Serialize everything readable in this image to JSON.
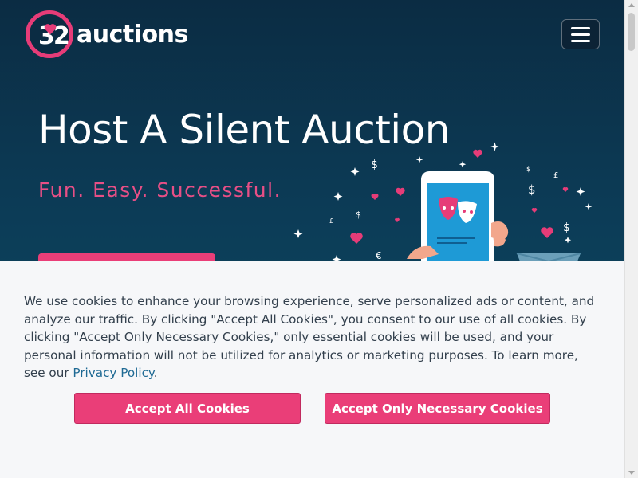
{
  "brand": {
    "digits": "32",
    "name": "auctions",
    "accent": "#e63c78"
  },
  "nav": {
    "menu_icon": "hamburger-icon"
  },
  "hero": {
    "title": "Host A Silent Auction",
    "subtitle": "Fun. Easy. Successful.",
    "background": "#0b3c57"
  },
  "cookie_banner": {
    "text_before_link": "We use cookies to enhance your browsing experience, serve personalized ads or content, and analyze our traffic. By clicking \"Accept All Cookies\", you consent to our use of all cookies. By clicking \"Accept Only Necessary Cookies,\" only essential cookies will be used, and your personal information will not be utilized for analytics or marketing purposes. To learn more, see our ",
    "link_text": "Privacy Policy",
    "text_after_link": ".",
    "accept_all_label": "Accept All Cookies",
    "accept_necessary_label": "Accept Only Necessary Cookies",
    "button_color": "#ea3e78"
  }
}
